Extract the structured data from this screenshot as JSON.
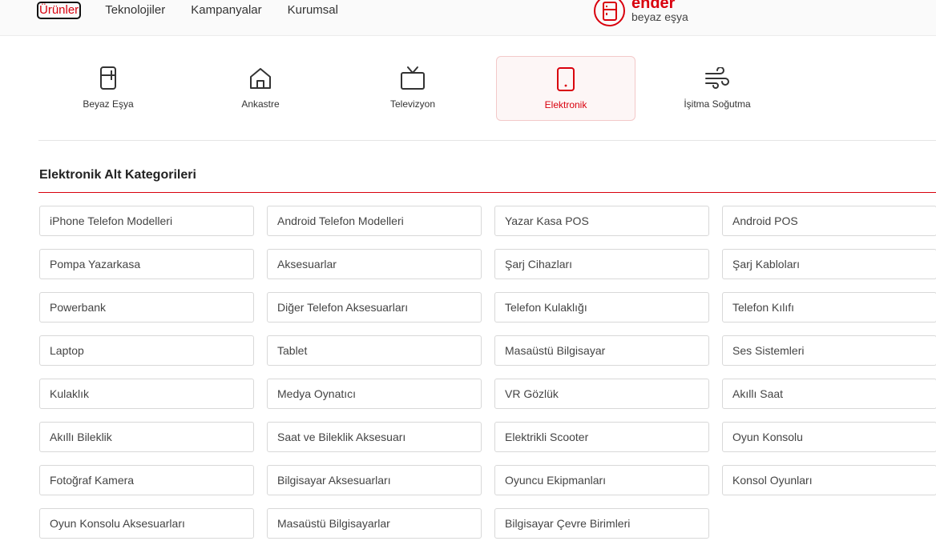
{
  "topnav": {
    "items": [
      "Ürünler",
      "Teknolojiler",
      "Kampanyalar",
      "Kurumsal"
    ]
  },
  "brand": {
    "name": "ender",
    "subtitle": "beyaz eşya",
    "color": "#d9000d"
  },
  "categories": [
    {
      "label": "Beyaz Eşya",
      "icon": "fridge-icon"
    },
    {
      "label": "Ankastre",
      "icon": "home-icon"
    },
    {
      "label": "Televizyon",
      "icon": "tv-icon"
    },
    {
      "label": "Elektronik",
      "icon": "phone-icon",
      "selected": true
    },
    {
      "label": "İşitma Soğutma",
      "icon": "wind-icon"
    }
  ],
  "section": {
    "title": "Elektronik Alt Kategorileri"
  },
  "subcategories": [
    "iPhone Telefon Modelleri",
    "Android Telefon Modelleri",
    "Yazar Kasa POS",
    "Android POS",
    "Pompa Yazarkasa",
    "Aksesuarlar",
    "Şarj Cihazları",
    "Şarj Kabloları",
    "Powerbank",
    "Diğer Telefon Aksesuarları",
    "Telefon Kulaklığı",
    "Telefon Kılıfı",
    "Laptop",
    "Tablet",
    "Masaüstü Bilgisayar",
    "Ses Sistemleri",
    "Kulaklık",
    "Medya Oynatıcı",
    "VR Gözlük",
    "Akıllı Saat",
    "Akıllı Bileklik",
    "Saat ve Bileklik Aksesuarı",
    "Elektrikli Scooter",
    "Oyun Konsolu",
    "Fotoğraf Kamera",
    "Bilgisayar Aksesuarları",
    "Oyuncu Ekipmanları",
    "Konsol Oyunları",
    "Oyun Konsolu Aksesuarları",
    "Masaüstü Bilgisayarlar",
    "Bilgisayar Çevre Birimleri"
  ]
}
